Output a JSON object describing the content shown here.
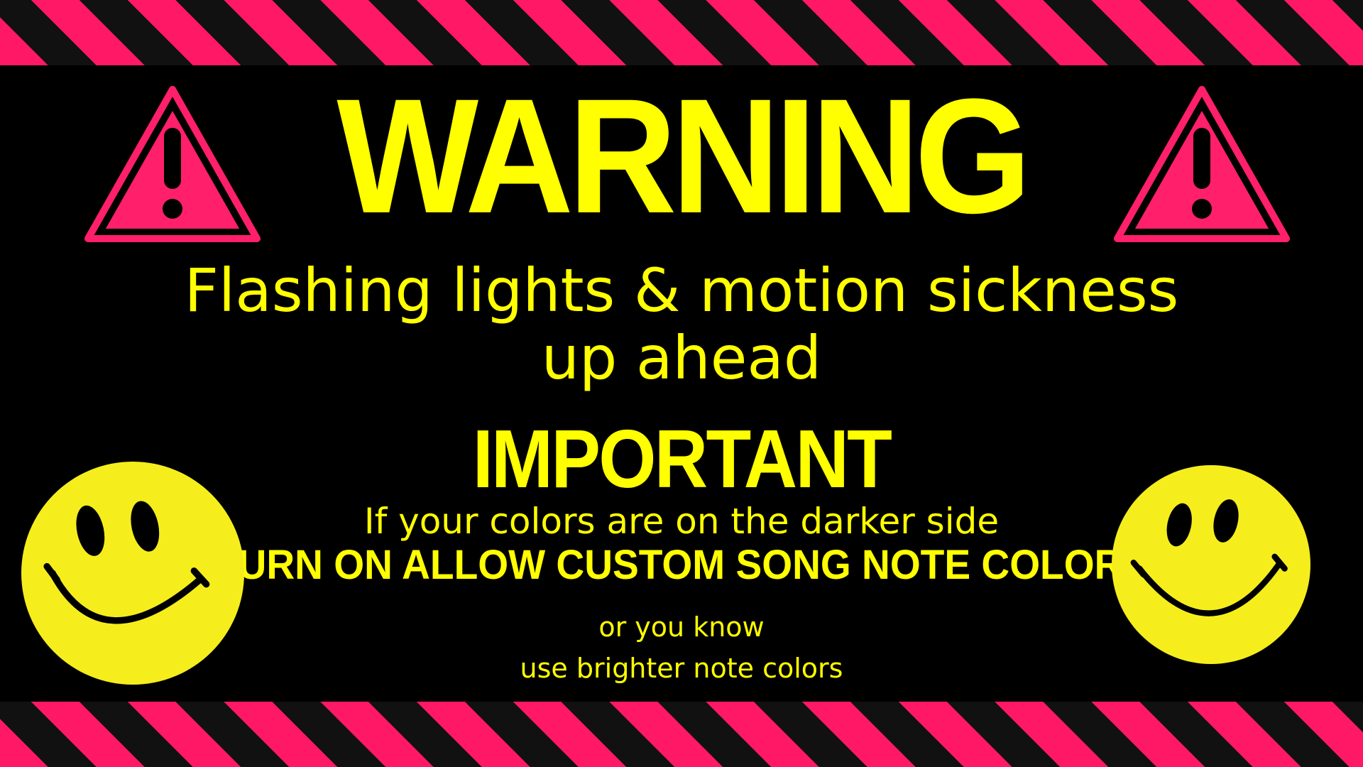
{
  "colors": {
    "background": "#000000",
    "stripe_pink": "#ff1866",
    "stripe_dark": "#111111",
    "text_yellow": "#ffff00",
    "icon_pink": "#ff1f6b",
    "smiley_yellow": "#f5ee1c"
  },
  "icons": {
    "left_warning": "warning-triangle-icon",
    "right_warning": "warning-triangle-icon",
    "left_face": "smiley-face-icon",
    "right_face": "smiley-face-icon"
  },
  "warning": {
    "title": "WARNING",
    "subtitle_line1": "Flashing lights & motion sickness",
    "subtitle_line2": "up ahead"
  },
  "important": {
    "title": "IMPORTANT",
    "line_darker": "If your colors are on the darker side",
    "line_custom": "TURN ON ALLOW CUSTOM SONG NOTE COLORS",
    "line_or": "or you know",
    "line_brighter": "use brighter note colors"
  }
}
